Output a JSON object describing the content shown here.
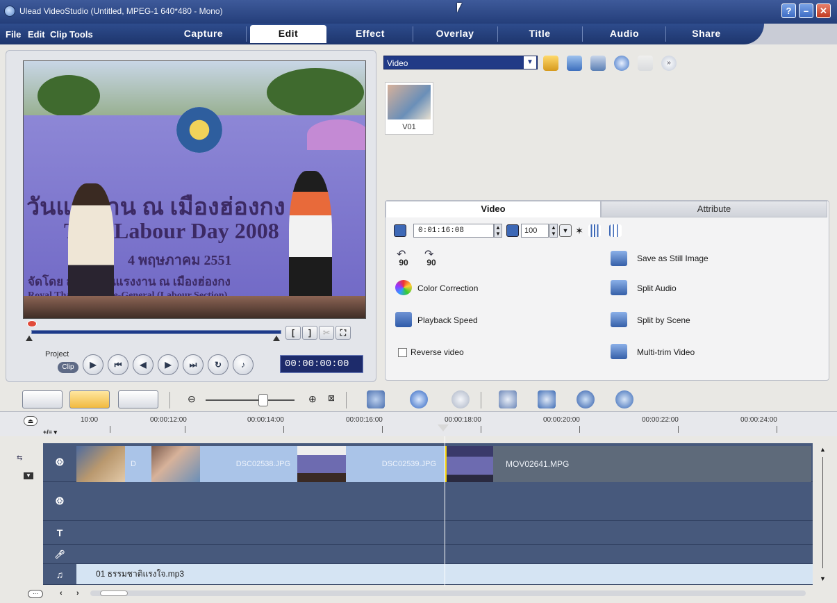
{
  "window": {
    "title": "Ulead VideoStudio (Untitled, MPEG-1 640*480 - Mono)"
  },
  "menu": {
    "file": "File",
    "edit": "Edit",
    "clip": "Clip",
    "tools": "Tools"
  },
  "steps": [
    {
      "label": "Capture"
    },
    {
      "label": "Edit"
    },
    {
      "label": "Effect"
    },
    {
      "label": "Overlay"
    },
    {
      "label": "Title"
    },
    {
      "label": "Audio"
    },
    {
      "label": "Share"
    }
  ],
  "preview": {
    "screen_text_line1": "วันแรงงาน ณ เมืองฮ่องกง",
    "screen_text_line2": "Thai Labour Day 2008",
    "screen_text_line3": "4 พฤษภาคม 2551",
    "screen_text_line4": "จัดโดย สำนักงานแรงงาน ณ เมืองฮ่องกง",
    "screen_text_line5": "Royal Thai Consulate-General (Labour Section)",
    "project_label": "Project",
    "clip_label": "Clip",
    "timecode": "00:00:00:00",
    "trim_mark_in": "[",
    "trim_mark_out": "]"
  },
  "library": {
    "selected_folder": "Video",
    "thumbnails": [
      {
        "label": "V01"
      }
    ]
  },
  "options": {
    "tabs": [
      {
        "label": "Video",
        "active": true
      },
      {
        "label": "Attribute",
        "active": false
      }
    ],
    "duration": "0:01:16:08",
    "volume": "100",
    "rotate_left": "90",
    "rotate_right": "90",
    "color_correction": "Color Correction",
    "playback_speed": "Playback Speed",
    "reverse_video": "Reverse video",
    "reverse_checked": false,
    "save_still": "Save as Still Image",
    "split_audio": "Split Audio",
    "split_scene": "Split by Scene",
    "multi_trim": "Multi-trim Video"
  },
  "timeline": {
    "ruler": [
      "10:00",
      "00:00:12:00",
      "00:00:14:00",
      "00:00:16:00",
      "00:00:18:00",
      "00:00:20:00",
      "00:00:22:00",
      "00:00:24:00"
    ],
    "add_label": "+/= ▾",
    "video_clips": [
      {
        "label": "D"
      },
      {
        "label": "DSC02538.JPG"
      },
      {
        "label": "DSC02539.JPG"
      },
      {
        "label": "MOV02641.MPG"
      }
    ],
    "audio_clip": "01 ธรรมชาติแรงใจ.mp3",
    "track_icons": {
      "video": "film-reel-icon",
      "overlay": "overlay-reel-icon",
      "title": "T",
      "voice": "microphone-icon",
      "music": "♫"
    }
  },
  "colors": {
    "titlebar": "#2f4a88",
    "track_bg": "#47597c",
    "photo_clip": "#aac4e8",
    "audio_clip": "#d5e4f3"
  }
}
